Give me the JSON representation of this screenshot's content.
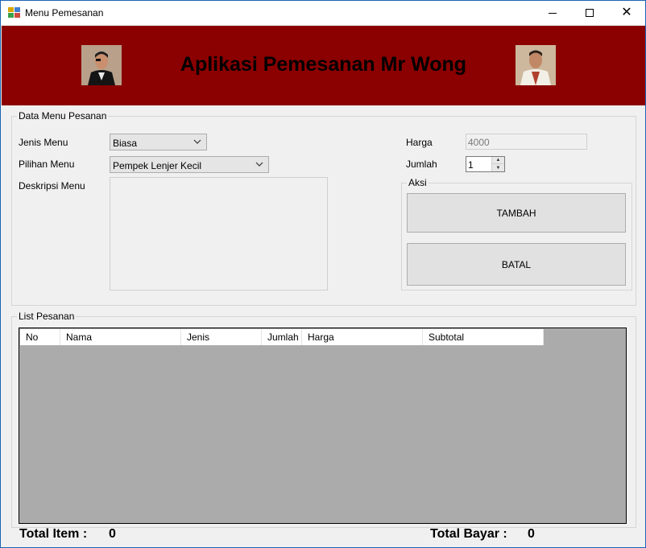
{
  "window": {
    "title": "Menu Pemesanan"
  },
  "header": {
    "title": "Aplikasi Pemesanan Mr Wong"
  },
  "data_menu": {
    "legend": "Data Menu Pesanan",
    "jenis_menu_label": "Jenis Menu",
    "jenis_menu_value": "Biasa",
    "pilihan_menu_label": "Pilihan Menu",
    "pilihan_menu_value": "Pempek Lenjer Kecil",
    "deskripsi_label": "Deskripsi Menu",
    "harga_label": "Harga",
    "harga_value": "4000",
    "jumlah_label": "Jumlah",
    "jumlah_value": "1"
  },
  "aksi": {
    "legend": "Aksi",
    "tambah_label": "TAMBAH",
    "batal_label": "BATAL"
  },
  "list_pesanan": {
    "legend": "List Pesanan",
    "columns": [
      "No",
      "Nama",
      "Jenis",
      "Jumlah",
      "Harga",
      "Subtotal"
    ]
  },
  "footer": {
    "total_item_label": "Total Item :",
    "total_item_value": "0",
    "total_bayar_label": "Total Bayar :",
    "total_bayar_value": "0"
  },
  "icons": [
    "app-icon",
    "minimize-icon",
    "maximize-icon",
    "close-icon",
    "chevron-down-icon",
    "spin-up-icon",
    "spin-down-icon"
  ],
  "colors": {
    "banner": "#8b0000",
    "window_border": "#1a64b4",
    "grid_background": "#ababab"
  }
}
